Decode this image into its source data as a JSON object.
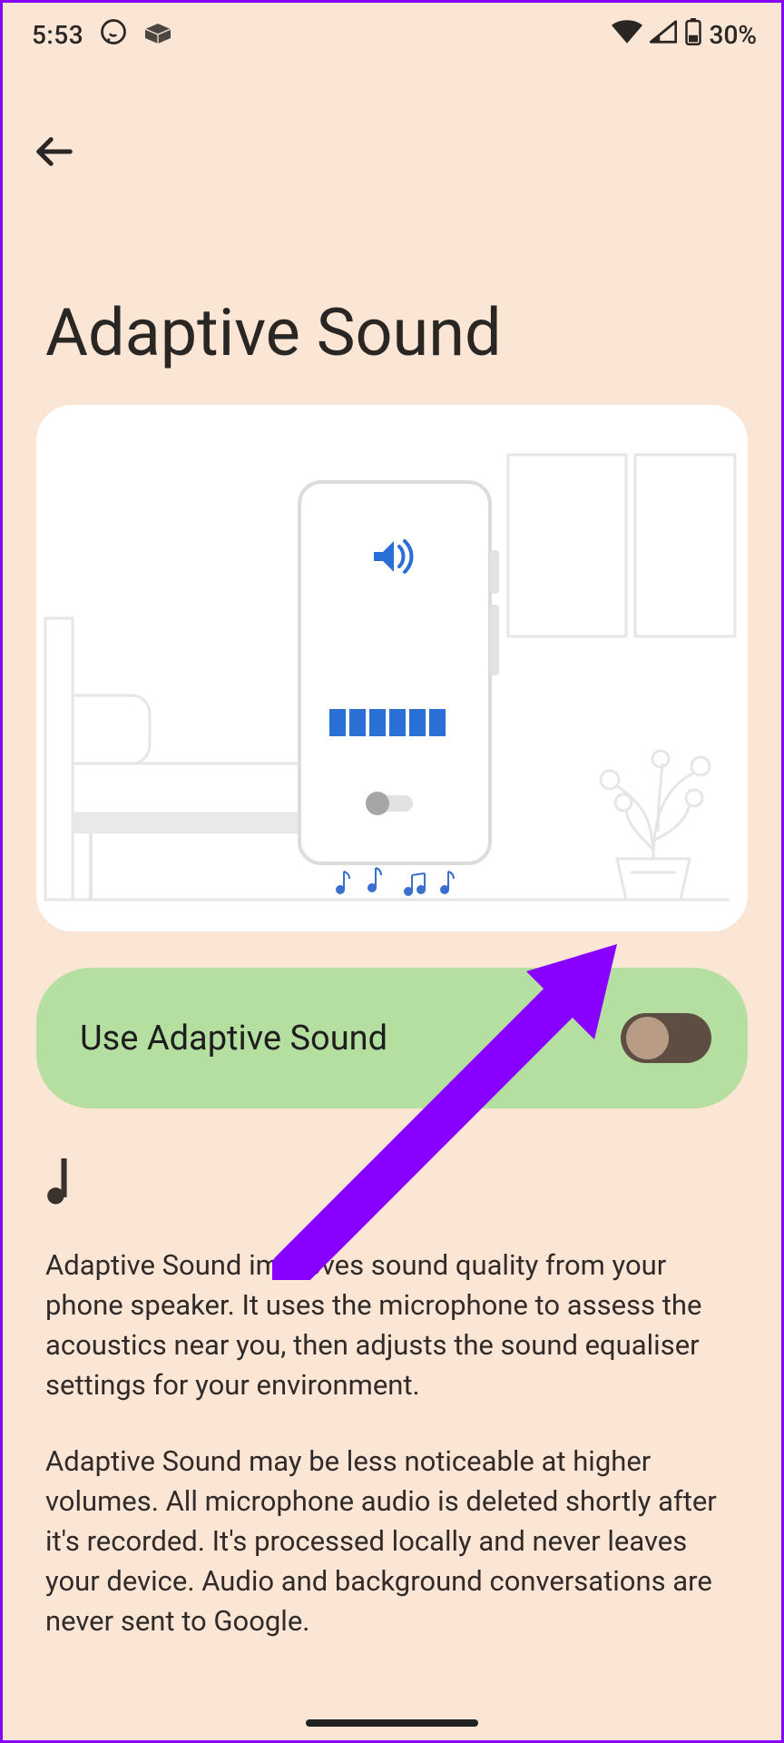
{
  "status": {
    "time": "5:53",
    "battery_percent": "30%"
  },
  "page": {
    "title": "Adaptive Sound"
  },
  "toggle": {
    "label": "Use Adaptive Sound",
    "state": "off"
  },
  "description": {
    "para1": "Adaptive Sound improves sound quality from your phone speaker. It uses the microphone to assess the acoustics near you, then adjusts the sound equaliser settings for your environment.",
    "para2": "Adaptive Sound may be less noticeable at higher volumes. All microphone audio is deleted shortly after it's recorded. It's processed locally and never leaves your device. Audio and background conversations are never sent to Google."
  }
}
